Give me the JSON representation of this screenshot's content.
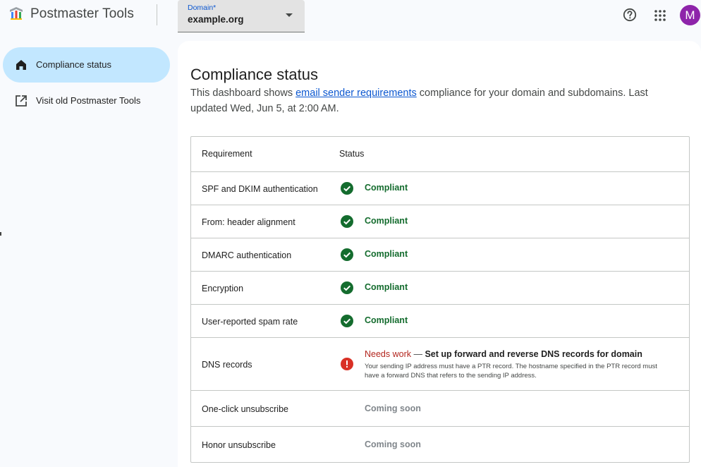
{
  "app": {
    "title": "Postmaster Tools"
  },
  "domain": {
    "label": "Domain*",
    "value": "example.org"
  },
  "avatar": {
    "initial": "M",
    "color": "#8e24aa"
  },
  "sidebar": {
    "items": [
      {
        "label": "Compliance status",
        "icon": "home-icon",
        "active": true
      },
      {
        "label": "Visit old Postmaster Tools",
        "icon": "open-in-new-icon",
        "active": false
      }
    ]
  },
  "page": {
    "title": "Compliance status",
    "desc_pre": "This dashboard shows ",
    "desc_link": "email sender requirements",
    "desc_post": " compliance for your domain and subdomains. Last updated Wed, Jun 5, at 2:00 AM."
  },
  "table": {
    "headers": {
      "requirement": "Requirement",
      "status": "Status"
    },
    "rows": [
      {
        "requirement": "SPF and DKIM authentication",
        "status": "Compliant"
      },
      {
        "requirement": "From: header alignment",
        "status": "Compliant"
      },
      {
        "requirement": "DMARC authentication",
        "status": "Compliant"
      },
      {
        "requirement": "Encryption",
        "status": "Compliant"
      },
      {
        "requirement": "User-reported spam rate",
        "status": "Compliant"
      },
      {
        "requirement": "DNS records",
        "status": "Needs work",
        "separator": " — ",
        "headline": "Set up forward and reverse DNS records for domain",
        "detail": "Your sending IP address must have a PTR record. The hostname specified in the PTR record must have a forward DNS that refers to the sending IP address."
      },
      {
        "requirement": "One-click unsubscribe",
        "status": "Coming soon"
      },
      {
        "requirement": "Honor unsubscribe",
        "status": "Coming soon"
      }
    ]
  },
  "colors": {
    "accent": "#0b57d0",
    "compliant": "#146c2e",
    "needs_work": "#b3261e",
    "active_nav": "#c2e7ff"
  }
}
